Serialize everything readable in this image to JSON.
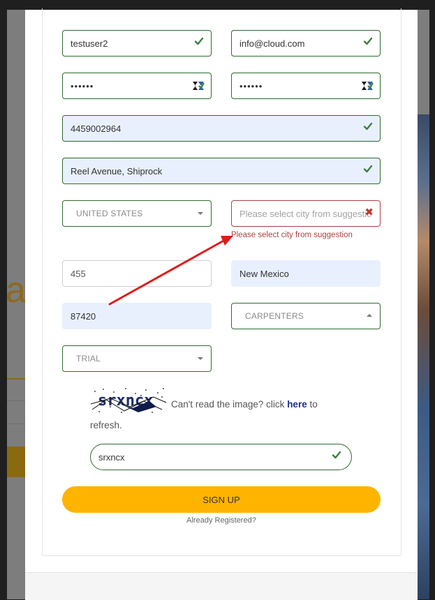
{
  "form": {
    "username": "testuser2",
    "email": "info@cloud.com",
    "password_mask": "••••••",
    "confirm_password_mask": "••••••",
    "phone": "4459002964",
    "address": "Reel Avenue, Shiprock",
    "country": "UNITED STATES",
    "city_placeholder": "Please select city from suggestion",
    "city_error": "Please select city from suggestion",
    "suite": "455",
    "state": "New Mexico",
    "zip": "87420",
    "trade": "CARPENTERS",
    "plan": "TRIAL"
  },
  "captcha": {
    "code": "srxncx",
    "prompt": "Can't read the image? click",
    "link": "here",
    "suffix": "to refresh.",
    "input": "srxncx"
  },
  "actions": {
    "signup": "SIGN UP",
    "already_registered": "Already Registered?"
  },
  "colors": {
    "valid": "#2e6b2e",
    "error": "#a94442",
    "accent": "#ffb400",
    "arrow": "#e01b1b",
    "autofill": "#e8f0fe"
  },
  "icons": [
    "check-icon",
    "error-x-icon",
    "password-manager-icon",
    "caret-down-icon",
    "caret-up-icon"
  ]
}
